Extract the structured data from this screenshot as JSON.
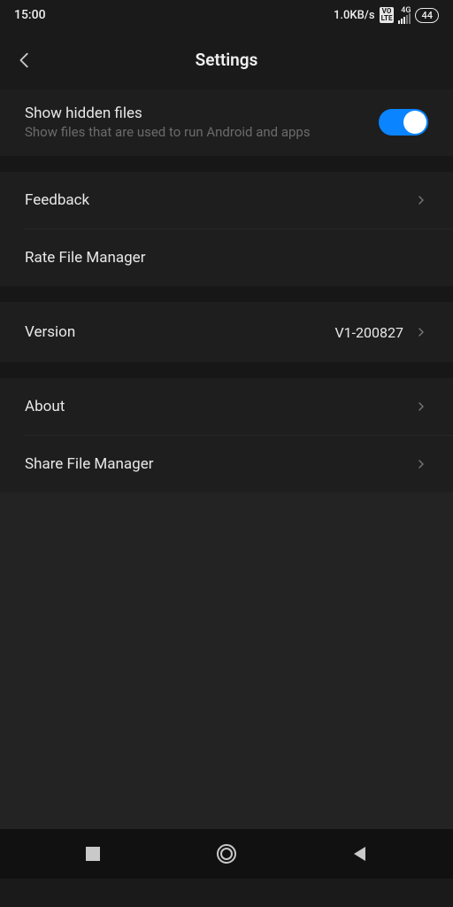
{
  "statusbar": {
    "time": "15:00",
    "net_speed": "1.0KB/s",
    "volte": "VO\nLTE",
    "signal_gen": "4G",
    "battery": "44"
  },
  "header": {
    "title": "Settings"
  },
  "hidden_files": {
    "title": "Show hidden files",
    "subtitle": "Show files that are used to run Android and apps",
    "enabled": true
  },
  "rows": {
    "feedback": "Feedback",
    "rate": "Rate File Manager",
    "version_label": "Version",
    "version_value": "V1-200827",
    "about": "About",
    "share": "Share File Manager"
  }
}
